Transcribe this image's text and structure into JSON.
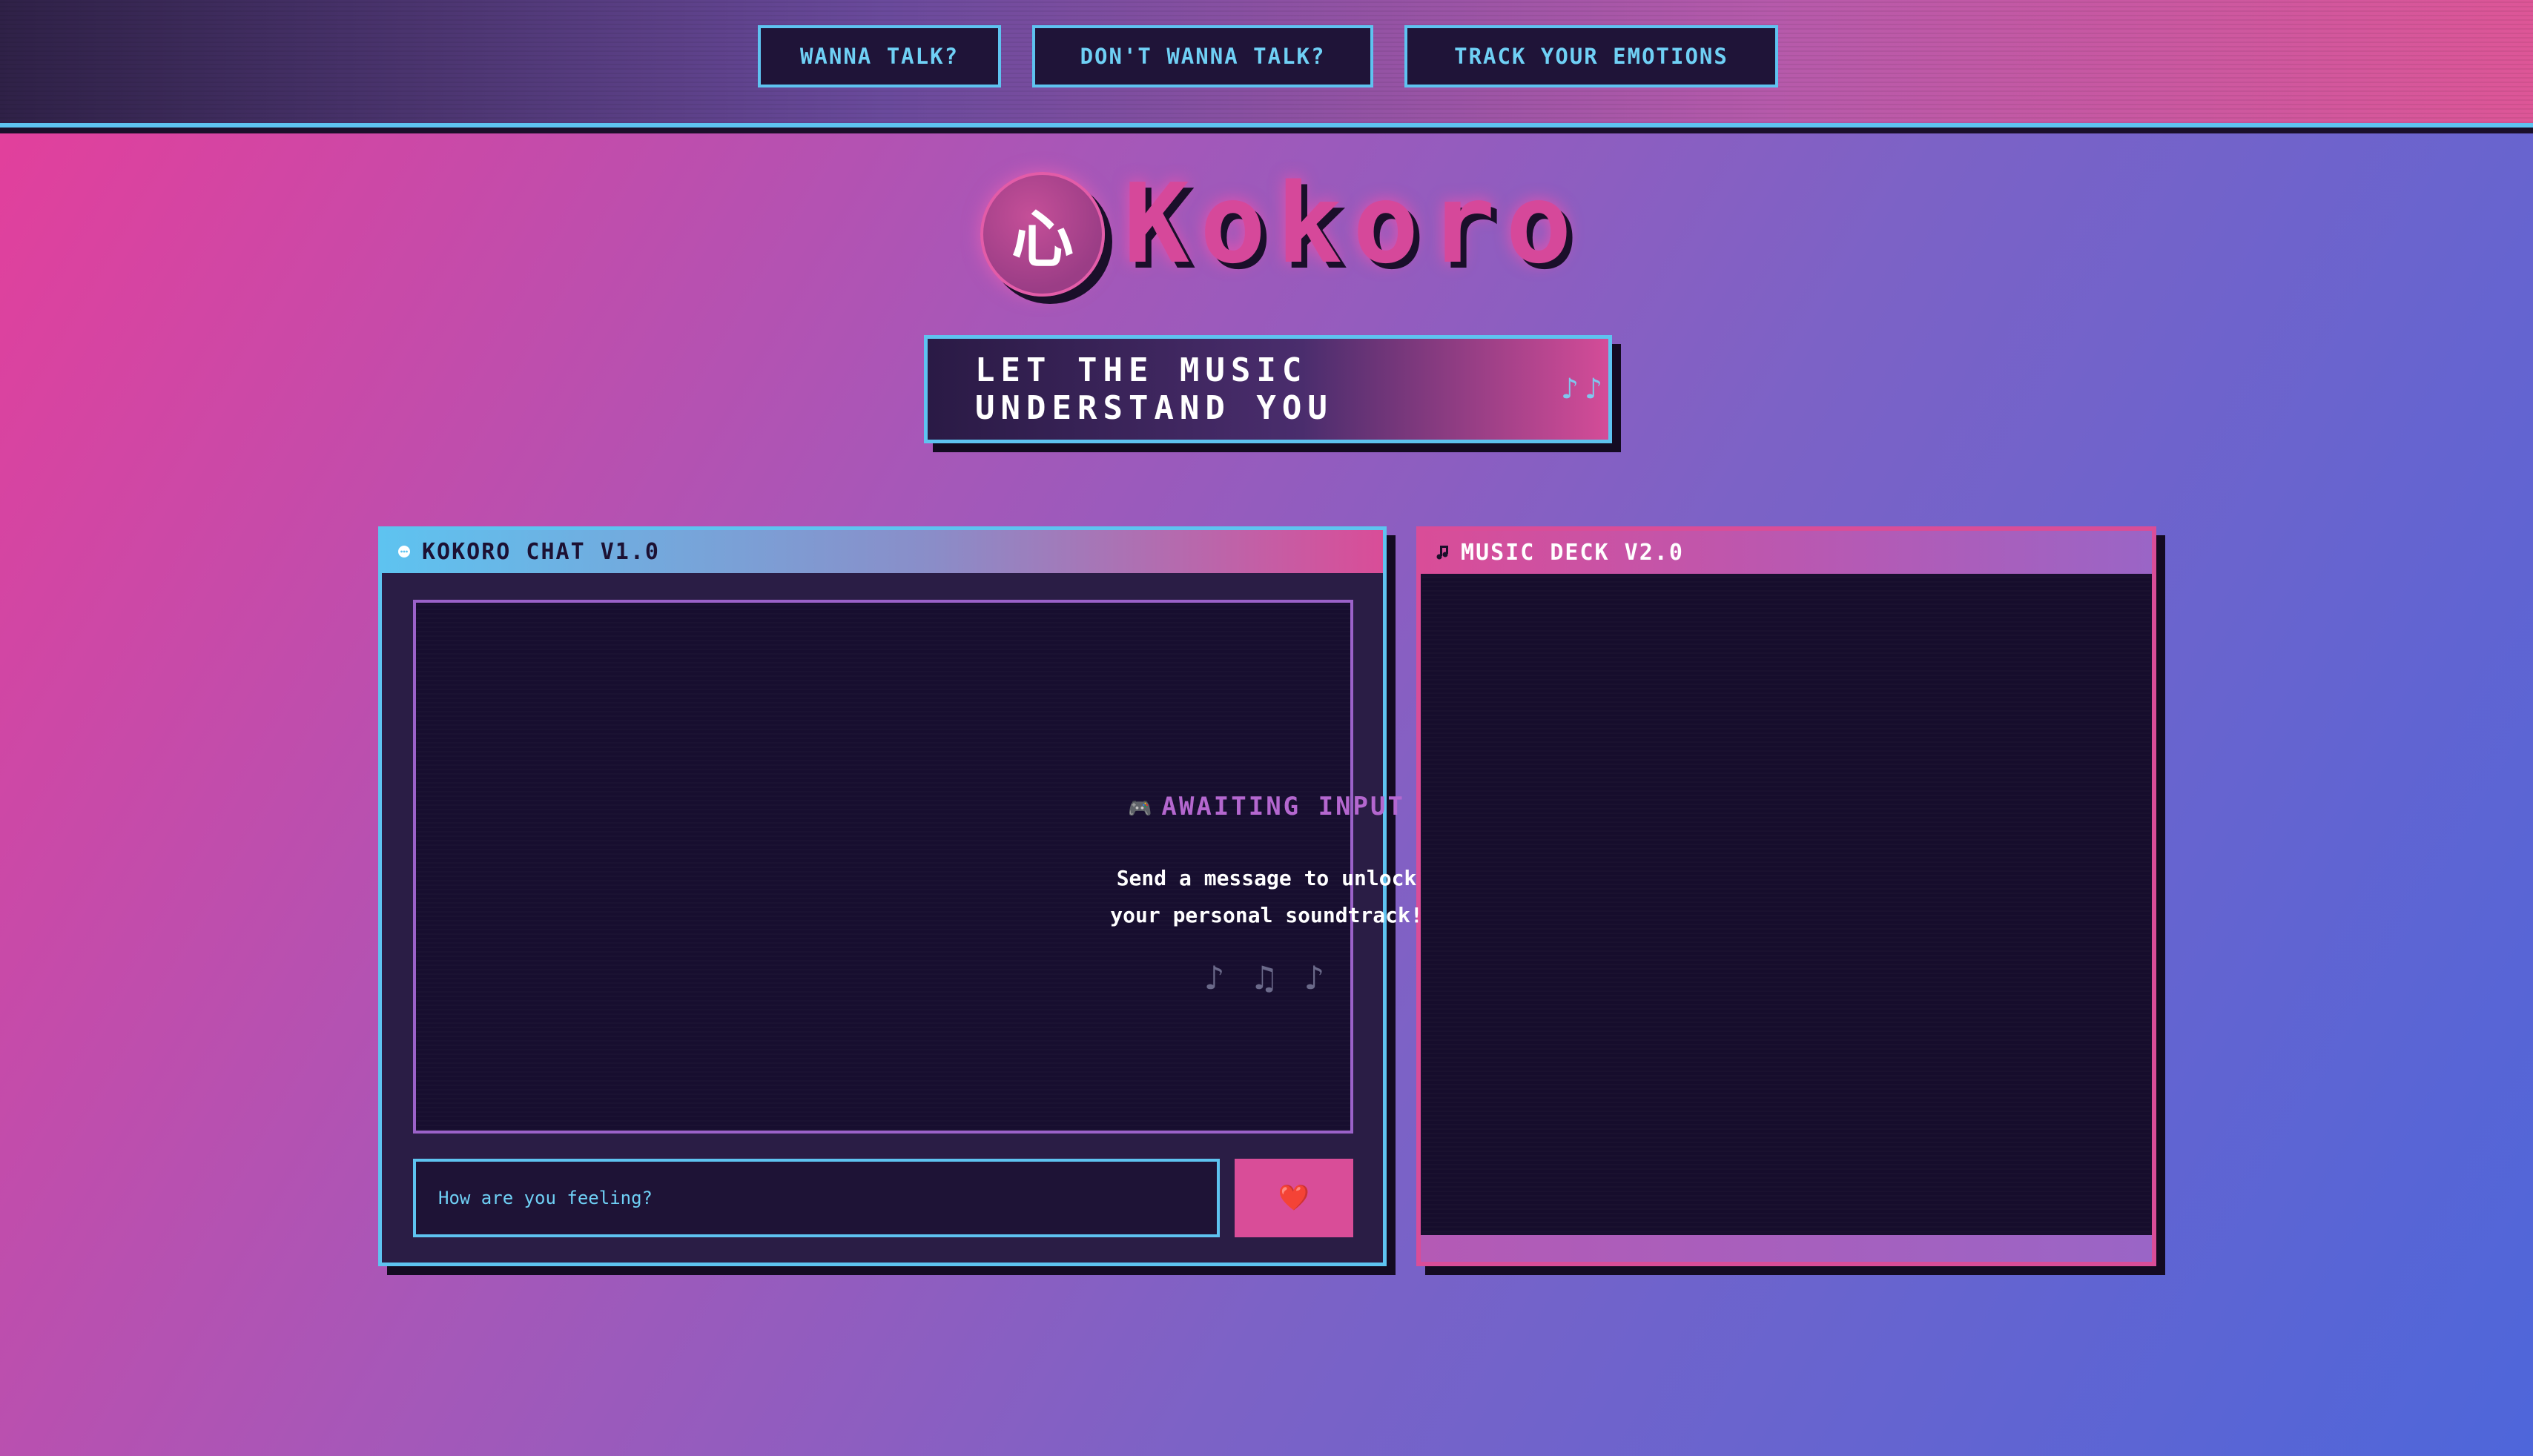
{
  "nav": {
    "items": [
      {
        "label": "WANNA TALK?"
      },
      {
        "label": "DON'T WANNA TALK?"
      },
      {
        "label": "TRACK YOUR EMOTIONS"
      }
    ]
  },
  "brand": {
    "logo_glyph": "心",
    "name": "Kokoro"
  },
  "tagline": {
    "text": "LET THE MUSIC UNDERSTAND YOU",
    "notes": "♪♪"
  },
  "chat": {
    "title": "KOKORO CHAT V1.0",
    "title_icon": "chat-bubble-icon",
    "input_placeholder": "How are you feeling?",
    "send_glyph": "❤️",
    "send_icon": "heart-icon"
  },
  "music": {
    "title": "MUSIC DECK V2.0",
    "title_icon": "music-note-icon",
    "status_icon": "gamepad-icon",
    "status_glyph": "🎮",
    "status": "AWAITING INPUT",
    "message_line1": "Send a message to unlock",
    "message_line2": "your personal soundtrack!",
    "notes": "♪ ♫ ♪"
  },
  "colors": {
    "accent_cyan": "#5ec3f0",
    "accent_pink": "#d94d98",
    "accent_purple": "#b467cf",
    "panel_dark": "#170e2f"
  }
}
